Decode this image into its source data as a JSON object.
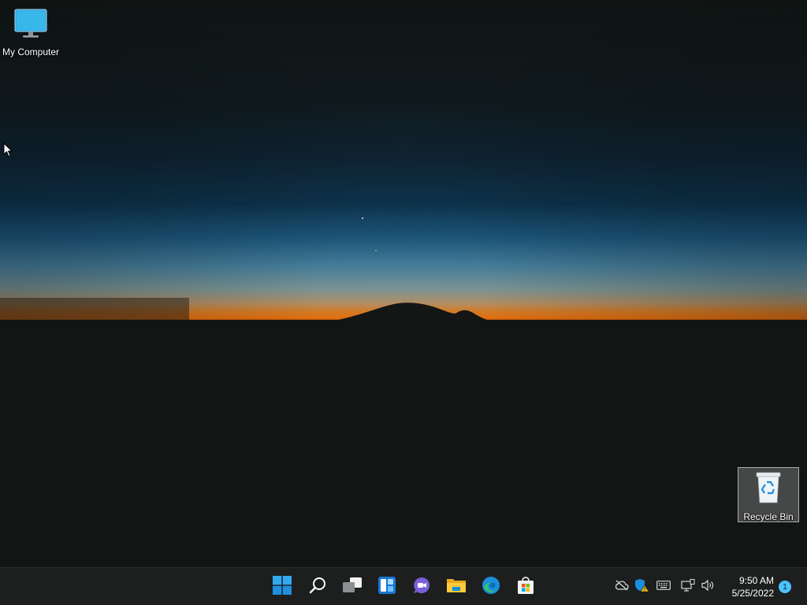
{
  "desktop": {
    "icons": [
      {
        "label": "My Computer",
        "icon": "monitor-icon"
      },
      {
        "label": "Recycle Bin",
        "icon": "recycle-bin-icon"
      }
    ]
  },
  "taskbar": {
    "apps": [
      {
        "name": "Start",
        "icon": "windows-start-icon"
      },
      {
        "name": "Search",
        "icon": "search-icon"
      },
      {
        "name": "Task View",
        "icon": "task-view-icon"
      },
      {
        "name": "Widgets",
        "icon": "widgets-icon"
      },
      {
        "name": "Chat",
        "icon": "chat-icon"
      },
      {
        "name": "File Explorer",
        "icon": "folder-icon"
      },
      {
        "name": "Microsoft Edge",
        "icon": "edge-icon"
      },
      {
        "name": "Microsoft Store",
        "icon": "store-icon"
      }
    ],
    "tray": [
      {
        "icon": "cloud-offline-icon"
      },
      {
        "icon": "security-warning-icon"
      },
      {
        "icon": "keyboard-icon"
      },
      {
        "icon": "network-icon"
      },
      {
        "icon": "volume-icon"
      }
    ],
    "clock": {
      "time": "9:50 AM",
      "date": "5/25/2022"
    },
    "notification_count": "1"
  },
  "colors": {
    "taskbar_bg": "#1c1f1e",
    "accent": "#4cc2ff",
    "horizon_orange": "#ff7a10"
  }
}
